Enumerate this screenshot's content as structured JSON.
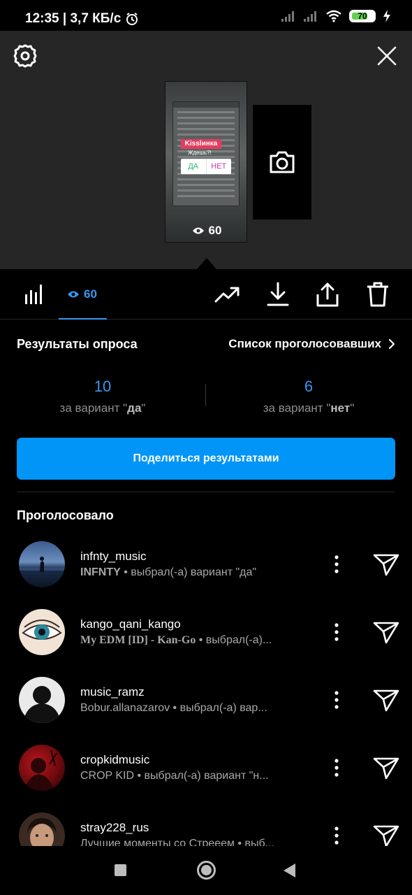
{
  "status_bar": {
    "time_speed": "12:35 | 3,7 КБ/с",
    "battery": "70"
  },
  "story_preview": {
    "poll_sticker_title": "Kisslинка",
    "poll_question": "Ждешь?!",
    "poll_option_yes": "ДА",
    "poll_option_no": "НЕТ",
    "views": "60"
  },
  "tabs": {
    "views_count": "60"
  },
  "poll_results": {
    "title": "Результаты опроса",
    "voters_list_link": "Список проголосовавших",
    "yes": {
      "count": "10",
      "label_prefix": "за вариант \"",
      "option": "да",
      "label_suffix": "\""
    },
    "no": {
      "count": "6",
      "label_prefix": "за вариант \"",
      "option": "нет",
      "label_suffix": "\""
    },
    "share_button": "Поделиться результатами"
  },
  "voters_section": {
    "title": "Проголосовало",
    "items": [
      {
        "username": "infnty_music",
        "name": "INFNTY",
        "action": " • выбрал(-а) вариант \"да\""
      },
      {
        "username": "kango_qani_kango",
        "name": "My EDM [ID] - Kan-Go",
        "action": " • выбрал(-а)..."
      },
      {
        "username": "music_ramz",
        "name": "Bobur.allanazarov",
        "action": " • выбрал(-а) вар..."
      },
      {
        "username": "cropkidmusic",
        "name": "CROP KID",
        "action": " • выбрал(-а) вариант \"н..."
      },
      {
        "username": "stray228_rus",
        "name": "Лучшие моменты со Стрееем",
        "action": " • выб..."
      }
    ]
  },
  "colors": {
    "accent": "#3897f0",
    "button": "#0095f6",
    "background": "#000000",
    "preview_bg": "#262626"
  },
  "icons": [
    "settings-icon",
    "close-icon",
    "camera-icon",
    "bar-chart-icon",
    "eye-icon",
    "trending-icon",
    "download-icon",
    "share-icon",
    "trash-icon",
    "chevron-right-icon",
    "more-vertical-icon",
    "send-icon"
  ]
}
